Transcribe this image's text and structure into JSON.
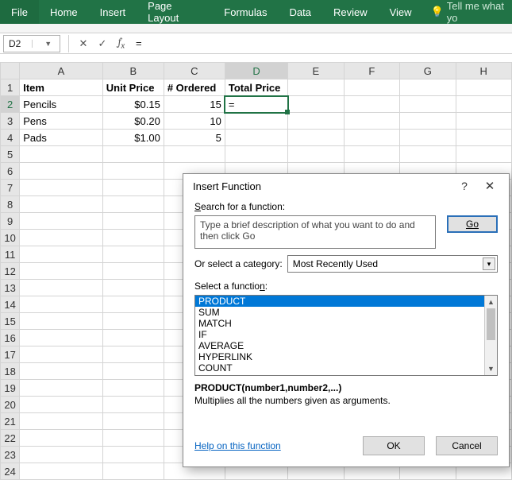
{
  "ribbon": {
    "tabs": [
      "File",
      "Home",
      "Insert",
      "Page Layout",
      "Formulas",
      "Data",
      "Review",
      "View"
    ],
    "tell": "Tell me what yo"
  },
  "namebox": "D2",
  "formula": "=",
  "columns": [
    "A",
    "B",
    "C",
    "D",
    "E",
    "F",
    "G",
    "H"
  ],
  "headers": {
    "a": "Item",
    "b": "Unit Price",
    "c": "# Ordered",
    "d": "Total Price"
  },
  "rows": [
    {
      "a": "Pencils",
      "b": "$0.15",
      "c": "15",
      "d": "="
    },
    {
      "a": "Pens",
      "b": "$0.20",
      "c": "10",
      "d": ""
    },
    {
      "a": "Pads",
      "b": "$1.00",
      "c": "5",
      "d": ""
    }
  ],
  "dialog": {
    "title": "Insert Function",
    "search_label": "Search for a function:",
    "search_text": "Type a brief description of what you want to do and then click Go",
    "go": "Go",
    "category_label": "Or select a category:",
    "category": "Most Recently Used",
    "selectfn_label": "Select a function:",
    "functions": [
      "PRODUCT",
      "SUM",
      "MATCH",
      "IF",
      "AVERAGE",
      "HYPERLINK",
      "COUNT"
    ],
    "signature": "PRODUCT(number1,number2,...)",
    "description": "Multiplies all the numbers given as arguments.",
    "help": "Help on this function",
    "ok": "OK",
    "cancel": "Cancel"
  }
}
